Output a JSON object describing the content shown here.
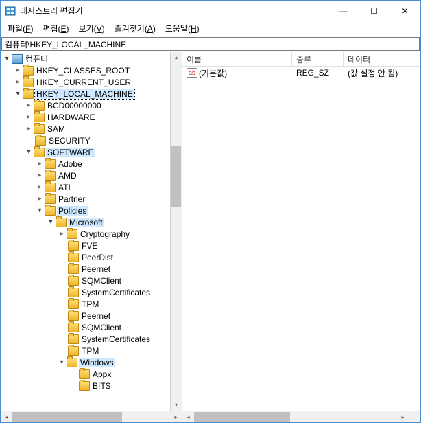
{
  "app": {
    "title": "레지스트리 편집기"
  },
  "win": {
    "min": "—",
    "max": "☐",
    "close": "✕"
  },
  "menu": {
    "file": "파일",
    "file_m": "F",
    "edit": "편집",
    "edit_m": "E",
    "view": "보기",
    "view_m": "V",
    "fav": "즐겨찾기",
    "fav_m": "A",
    "help": "도움말",
    "help_m": "H"
  },
  "address": "컴퓨터\\HKEY_LOCAL_MACHINE",
  "tree": {
    "root": "컴퓨터",
    "hkcr": "HKEY_CLASSES_ROOT",
    "hkcu": "HKEY_CURRENT_USER",
    "hklm": "HKEY_LOCAL_MACHINE",
    "bcd": "BCD00000000",
    "hw": "HARDWARE",
    "sam": "SAM",
    "sec": "SECURITY",
    "sw": "SOFTWARE",
    "adobe": "Adobe",
    "amd": "AMD",
    "ati": "ATI",
    "partner": "Partner",
    "policies": "Policies",
    "ms": "Microsoft",
    "crypto": "Cryptography",
    "fve": "FVE",
    "peerdist": "PeerDist",
    "peernet1": "Peernet",
    "sqm1": "SQMClient",
    "syscert1": "SystemCertificates",
    "tpm1": "TPM",
    "peernet2": "Peernet",
    "sqm2": "SQMClient",
    "syscert2": "SystemCertificates",
    "tpm2": "TPM",
    "windows": "Windows",
    "appx": "Appx",
    "bits": "BITS"
  },
  "list": {
    "col_name": "이름",
    "col_type": "종류",
    "col_data": "데이터",
    "rows": [
      {
        "name": "(기본값)",
        "type": "REG_SZ",
        "data": "(값 설정 안 됨)"
      }
    ]
  },
  "glyph": {
    "right": "▸",
    "down": "▾",
    "up": "▴",
    "left": "◂",
    "right2": "▸",
    "ab": "ab"
  }
}
